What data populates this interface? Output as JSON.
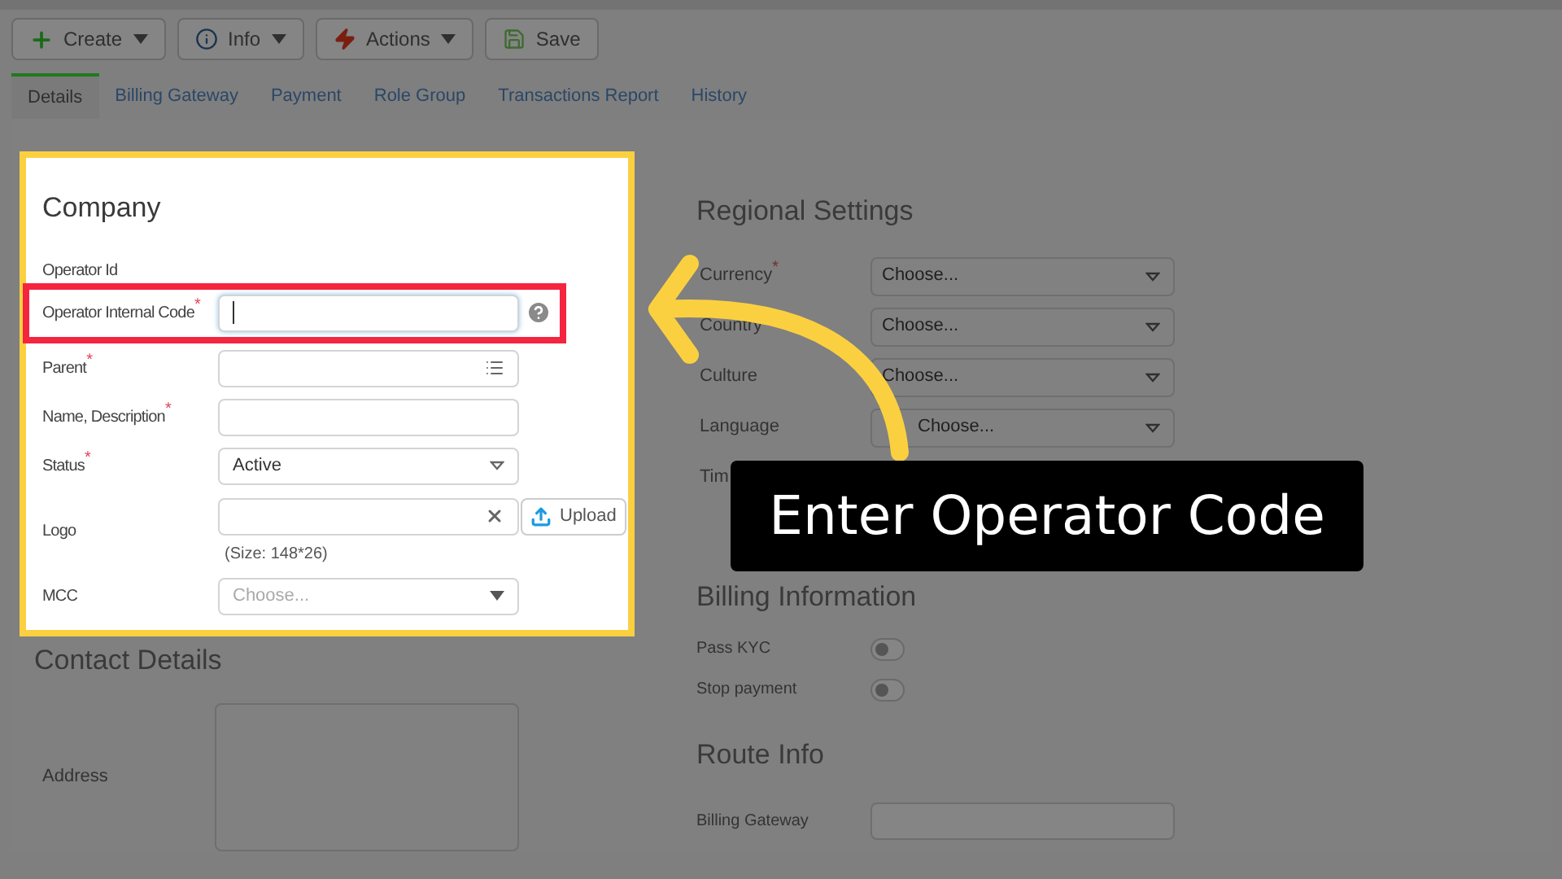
{
  "toolbar": [
    {
      "kind": "create",
      "label": "Create",
      "dropdown": true
    },
    {
      "kind": "info",
      "label": "Info",
      "dropdown": true
    },
    {
      "kind": "actions",
      "label": "Actions",
      "dropdown": true
    },
    {
      "kind": "save",
      "label": "Save",
      "dropdown": false
    }
  ],
  "tabs": [
    {
      "label": "Details",
      "selected": true
    },
    {
      "label": "Billing Gateway",
      "selected": false
    },
    {
      "label": "Payment",
      "selected": false
    },
    {
      "label": "Role Group",
      "selected": false
    },
    {
      "label": "Transactions Report",
      "selected": false
    },
    {
      "label": "History",
      "selected": false
    }
  ],
  "company": {
    "title": "Company",
    "fields": [
      {
        "kind": "plain",
        "label": "Operator Id"
      },
      {
        "kind": "text",
        "label": "Operator Internal Code$^{*}$",
        "highlighted": true,
        "help": true
      },
      {
        "kind": "lookup",
        "label": "Parent$^{*}$"
      },
      {
        "kind": "text",
        "label": "Name, Description$^{*}$"
      },
      {
        "kind": "select",
        "label": "Status$^{*}$",
        "value": "Active"
      },
      {
        "kind": "upload",
        "label": "Logo",
        "button": "Upload",
        "note": "(Size: 148*26)"
      },
      {
        "kind": "combo",
        "label": "MCC",
        "placeholder": "Choose..."
      }
    ]
  },
  "contact": {
    "title": "Contact Details",
    "fields": [
      {
        "kind": "textarea",
        "label": "Address"
      }
    ]
  },
  "regional": {
    "title": "Regional Settings",
    "fields": [
      {
        "label": "Currency$^{*}$",
        "value": "Choose..."
      },
      {
        "label": "Country",
        "value": "Choose..."
      },
      {
        "label": "Culture",
        "value": "Choose..."
      },
      {
        "label": "Language",
        "value": "Choose..."
      },
      {
        "label": "Tim"
      }
    ]
  },
  "billing": {
    "title": "Billing Information",
    "toggles": [
      {
        "label": "Pass KYC",
        "on": false
      },
      {
        "label": "Stop payment",
        "on": false
      }
    ]
  },
  "route": {
    "title": "Route Info",
    "fields": [
      {
        "label": "Billing Gateway"
      }
    ]
  },
  "callout": {
    "text": "Enter Operator Code"
  }
}
